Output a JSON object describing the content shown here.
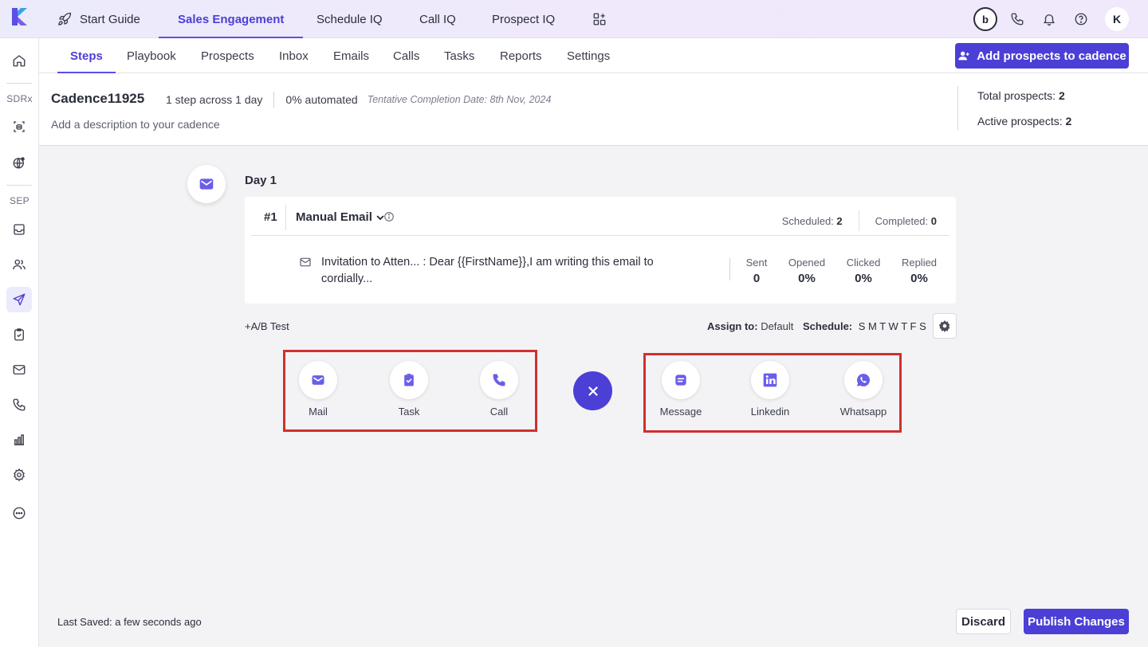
{
  "app": {
    "tabs": [
      {
        "label": "Start Guide",
        "icon": "rocket-icon"
      },
      {
        "label": "Sales Engagement",
        "active": true
      },
      {
        "label": "Schedule IQ"
      },
      {
        "label": "Call IQ"
      },
      {
        "label": "Prospect IQ"
      }
    ],
    "avatar_initial": "K",
    "brand_letter": "b"
  },
  "sidebar": {
    "section_sdrx": "SDRx",
    "section_sep": "SEP"
  },
  "subnav": {
    "tabs": [
      "Steps",
      "Playbook",
      "Prospects",
      "Inbox",
      "Emails",
      "Calls",
      "Tasks",
      "Reports",
      "Settings"
    ],
    "add_button": "Add prospects to cadence"
  },
  "cadence": {
    "name": "Cadence11925",
    "steps_summary": "1 step across 1 day",
    "automated": "0% automated",
    "tentative": "Tentative Completion Date: 8th Nov, 2024",
    "description": "Add a description to your cadence",
    "total_label": "Total prospects:",
    "total_value": "2",
    "active_label": "Active prospects:",
    "active_value": "2"
  },
  "day": {
    "label": "Day 1",
    "step": {
      "number": "#1",
      "type": "Manual Email",
      "scheduled_label": "Scheduled:",
      "scheduled_value": "2",
      "completed_label": "Completed:",
      "completed_value": "0",
      "email_preview": "Invitation to Atten... : Dear {{FirstName}},I am writing this email to cordially...",
      "metrics": [
        {
          "label": "Sent",
          "value": "0"
        },
        {
          "label": "Opened",
          "value": "0%"
        },
        {
          "label": "Clicked",
          "value": "0%"
        },
        {
          "label": "Replied",
          "value": "0%"
        }
      ]
    },
    "ab_test": "+A/B Test",
    "assign_label": "Assign to:",
    "assign_value": "Default",
    "schedule_label": "Schedule:",
    "schedule_days": "S M T W T F S"
  },
  "actions": {
    "left": [
      {
        "label": "Mail",
        "icon": "mail-icon"
      },
      {
        "label": "Task",
        "icon": "task-icon"
      },
      {
        "label": "Call",
        "icon": "phone-icon"
      }
    ],
    "right": [
      {
        "label": "Message",
        "icon": "message-icon"
      },
      {
        "label": "Linkedin",
        "icon": "linkedin-icon"
      },
      {
        "label": "Whatsapp",
        "icon": "whatsapp-icon"
      }
    ]
  },
  "footer": {
    "last_saved": "Last Saved: a few seconds ago",
    "discard": "Discard",
    "publish": "Publish Changes"
  },
  "colors": {
    "accent": "#4b3fd6",
    "highlight_box": "#d0302f",
    "background": "#f3f3f6"
  }
}
